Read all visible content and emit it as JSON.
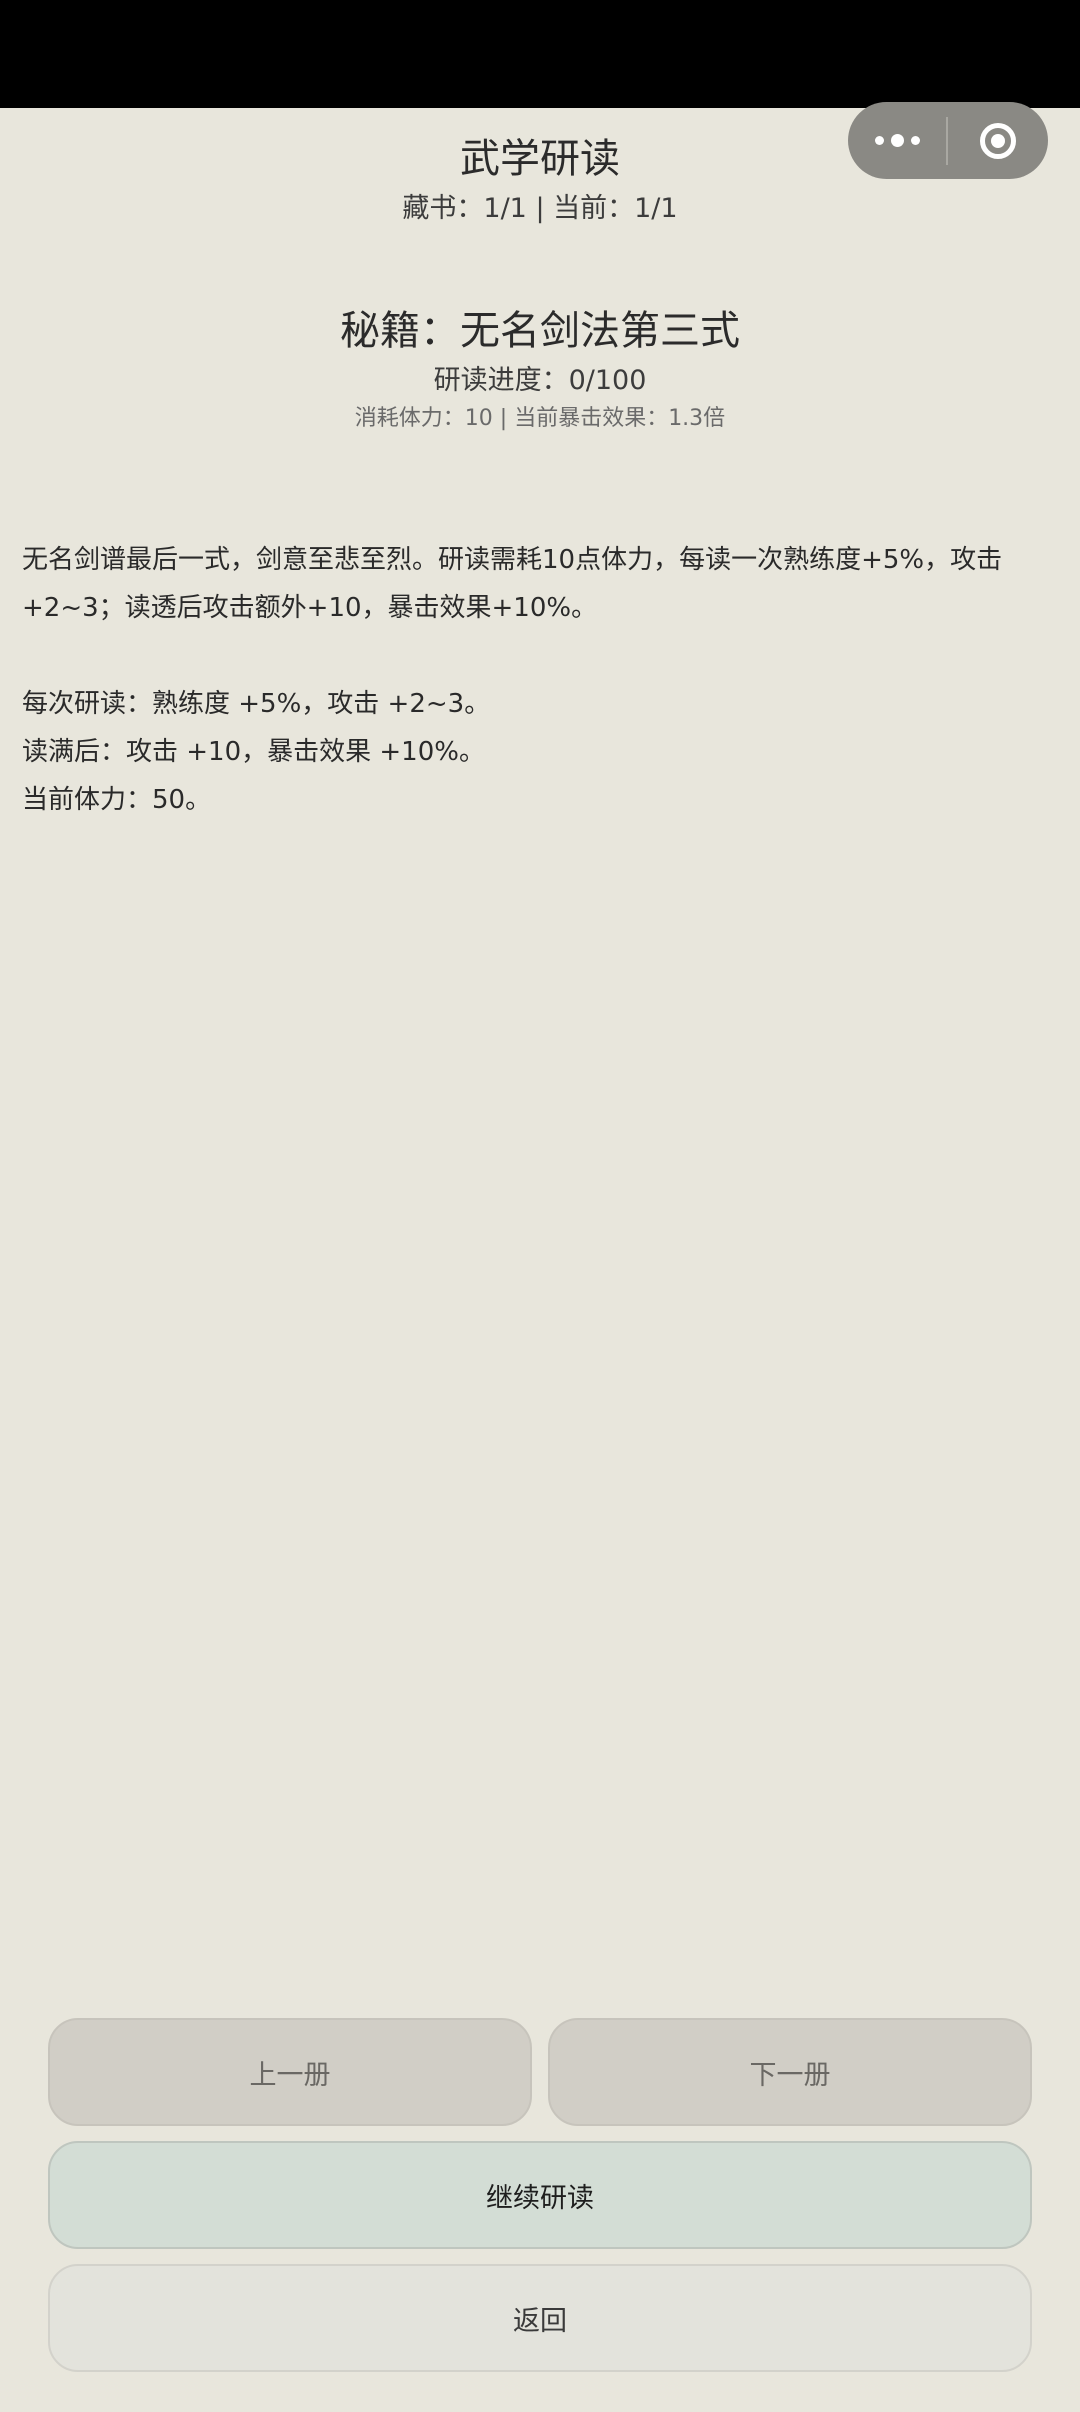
{
  "header": {
    "title": "武学研读",
    "subtitle": "藏书：1/1 | 当前：1/1"
  },
  "book": {
    "title": "秘籍：无名剑法第三式",
    "progress": "研读进度：0/100",
    "meta": "消耗体力：10 | 当前暴击效果：1.3倍"
  },
  "description": {
    "intro": "无名剑谱最后一式，剑意至悲至烈。研读需耗10点体力，每读一次熟练度+5%，攻击+2~3；读透后攻击额外+10，暴击效果+10%。",
    "per_read": "每次研读：熟练度 +5%，攻击 +2~3。",
    "on_full": "读满后：攻击 +10，暴击效果 +10%。",
    "stamina": "当前体力：50。"
  },
  "buttons": {
    "prev": "上一册",
    "next": "下一册",
    "continue": "继续研读",
    "back": "返回"
  },
  "capsule": {
    "more_icon": "more-dots-icon",
    "close_icon": "target-close-icon"
  },
  "colors": {
    "background": "#e8e6dc",
    "status_bar": "#000000",
    "capsule": "#8a8984",
    "nav_button": "#d1cec6",
    "primary_button": "#d3ddd5",
    "back_button": "#e3e3dc"
  }
}
